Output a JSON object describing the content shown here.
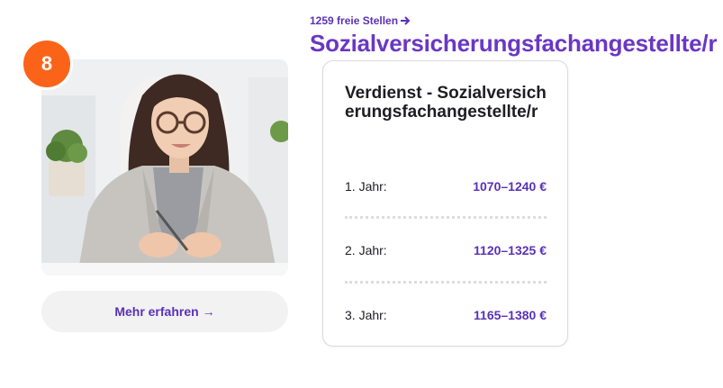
{
  "rank": "8",
  "photo_alt": "Frau mit Brille im Büro",
  "cta": {
    "label": "Mehr erfahren",
    "arrow": "→"
  },
  "jobs_link": {
    "label": "1259 freie Stellen",
    "arrow_icon": "arrow-right-icon"
  },
  "job_title": "Sozialversicherungsfachangestellte/r",
  "salary_card": {
    "title": "Verdienst - Sozialversicherungsfachangestellte/r",
    "rows": [
      {
        "year": "1. Jahr:",
        "amount": "1070–1240 €"
      },
      {
        "year": "2. Jahr:",
        "amount": "1120–1325 €"
      },
      {
        "year": "3. Jahr:",
        "amount": "1165–1380 €"
      }
    ]
  },
  "colors": {
    "accent": "#6a37c4",
    "link": "#5a31b8",
    "badge": "#fb6418",
    "button_bg": "#f2f2f2"
  }
}
